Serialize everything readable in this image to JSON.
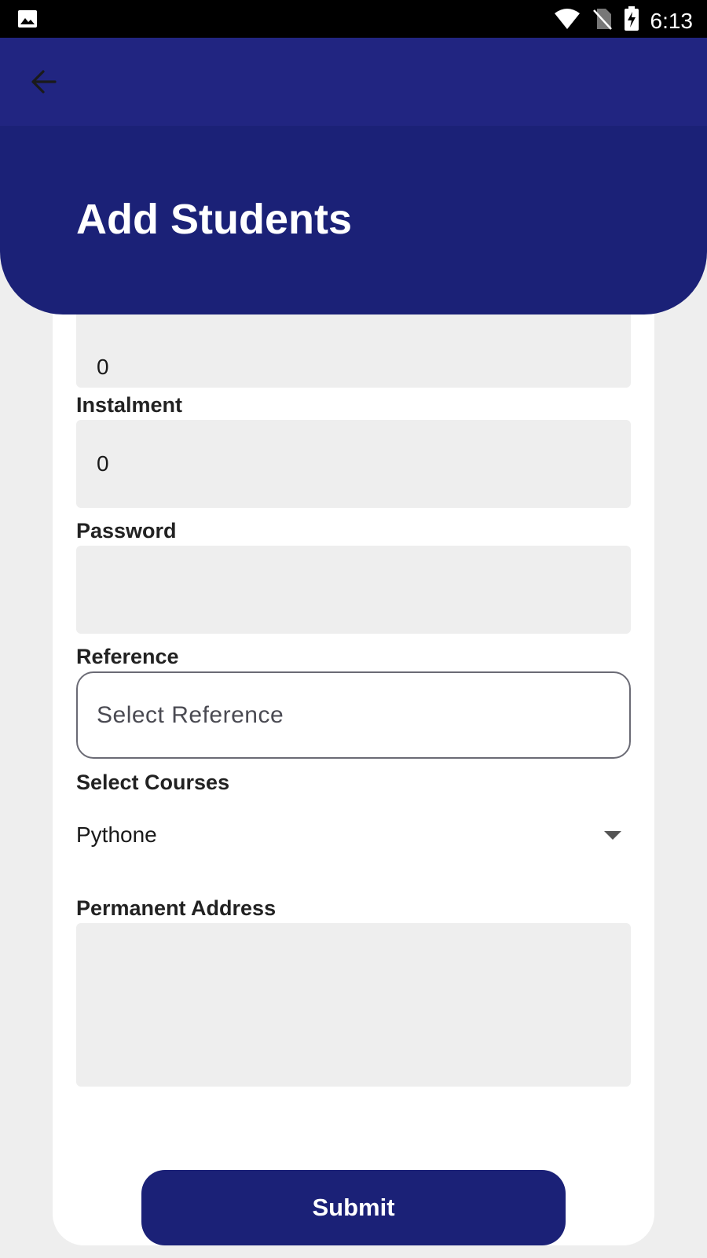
{
  "status_bar": {
    "time": "6:13",
    "icons": [
      "image-icon",
      "wifi-icon",
      "no-sim-icon",
      "battery-charging-icon"
    ]
  },
  "header": {
    "title": "Add Students",
    "back_icon": "arrow-left-icon"
  },
  "form": {
    "partial_field_value": "0",
    "instalment": {
      "label": "Instalment",
      "value": "0"
    },
    "password": {
      "label": "Password",
      "value": ""
    },
    "reference": {
      "label": "Reference",
      "placeholder": "Select Reference"
    },
    "courses": {
      "label": "Select Courses",
      "selected": "Pythone"
    },
    "permanent_address": {
      "label": "Permanent Address",
      "value": ""
    }
  },
  "submit_label": "Submit",
  "colors": {
    "primary": "#1b2177",
    "field_bg": "#eeeeee",
    "page_bg": "#eeeeee"
  }
}
